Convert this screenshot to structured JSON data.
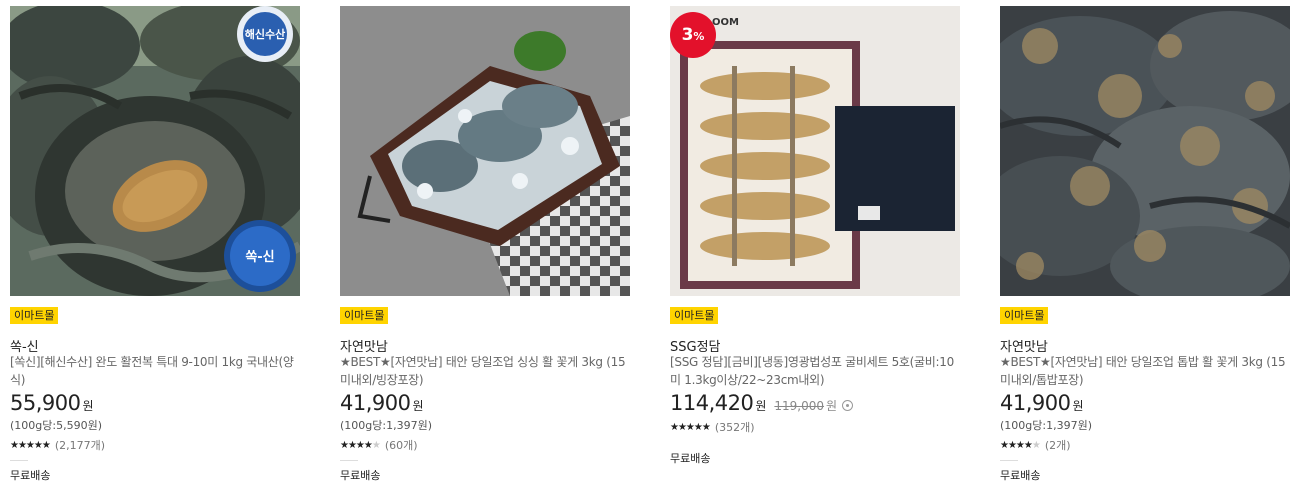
{
  "products": [
    {
      "mall_tag": "이마트몰",
      "brand": "쏙-신",
      "title": "[쏙신][해신수산] 완도 활전복 특대 9-10미 1kg 국내산(양식)",
      "price": "55,900",
      "currency": "원",
      "unit_price": "(100g당:5,590원)",
      "rating_stars": "★★★★★",
      "rating_stars_off": "",
      "review_count": "(2,177개)",
      "shipping": "무료배송",
      "image": {
        "logo_text": "해신수산",
        "sticker_text": "쏙-신"
      }
    },
    {
      "mall_tag": "이마트몰",
      "brand": "자연맛남",
      "title": "★BEST★[자연맛남] 태안 당일조업 싱싱 활 꽃게 3kg (15미내외/빙장포장)",
      "price": "41,900",
      "currency": "원",
      "unit_price": "(100g당:1,397원)",
      "rating_stars": "★★★★",
      "rating_stars_off": "★",
      "review_count": "(60개)",
      "shipping": "무료배송"
    },
    {
      "mall_tag": "이마트몰",
      "brand": "SSG정담",
      "title": "[SSG 정담][금비][냉동]영광법성포 굴비세트 5호(굴비:10미 1.3kg이상/22~23cm내외)",
      "price": "114,420",
      "currency": "원",
      "original_price": "119,000",
      "original_currency": "원",
      "sale_badge": {
        "value": "3",
        "unit": "%"
      },
      "rating_stars": "★★★★★",
      "rating_stars_off": "",
      "review_count": "(352개)",
      "shipping": "무료배송",
      "image": {
        "corner_text": "OOM"
      }
    },
    {
      "mall_tag": "이마트몰",
      "brand": "자연맛남",
      "title": "★BEST★[자연맛남] 태안 당일조업 톱밥 활 꽃게 3kg (15미내외/톱밥포장)",
      "price": "41,900",
      "currency": "원",
      "unit_price": "(100g당:1,397원)",
      "rating_stars": "★★★★",
      "rating_stars_off": "★",
      "review_count": "(2개)",
      "shipping": "무료배송"
    }
  ],
  "colors": {
    "mall_tag_bg": "#ffd400",
    "sale_badge_bg": "#e3112b",
    "price_text": "#222222",
    "secondary_text": "#666666"
  }
}
